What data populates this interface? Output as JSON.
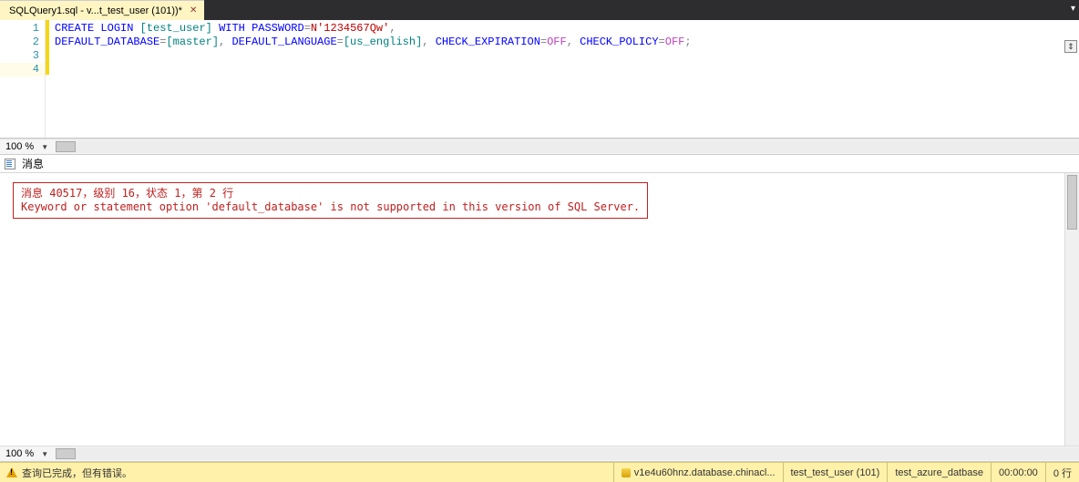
{
  "tab": {
    "title": "SQLQuery1.sql - v...t_test_user (101))*",
    "close": "✕"
  },
  "editor": {
    "lines": [
      "1",
      "2",
      "3",
      "4"
    ],
    "l1": {
      "a": "CREATE",
      "b": "LOGIN",
      "c": "[test_user]",
      "d": "WITH",
      "e": "PASSWORD",
      "eq": "=",
      "f": "N'1234567Qw'",
      "g": ","
    },
    "l2": {
      "a": "DEFAULT_DATABASE",
      "eq1": "=",
      "b": "[master]",
      "c": ",",
      "d": "DEFAULT_LANGUAGE",
      "eq2": "=",
      "e": "[us_english]",
      "f": ",",
      "g": "CHECK_EXPIRATION",
      "eq3": "=",
      "h": "OFF",
      "i": ",",
      "j": "CHECK_POLICY",
      "eq4": "=",
      "k": "OFF",
      "l": ";"
    }
  },
  "zoom": "100 %",
  "messages": {
    "header": "消息",
    "err1": "消息 40517，级别 16，状态 1，第 2 行",
    "err2": "Keyword or statement option 'default_database' is not supported in this version of SQL Server."
  },
  "status": {
    "text": "查询已完成，但有错误。",
    "server": "v1e4u60hnz.database.chinacl...",
    "user": "test_test_user (101)",
    "db": "test_azure_datbase",
    "time": "00:00:00",
    "rows": "0 行"
  }
}
